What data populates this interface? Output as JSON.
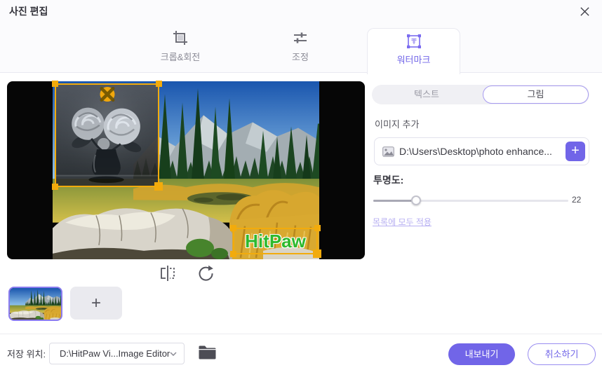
{
  "window": {
    "title": "사진 편집"
  },
  "tabs": {
    "crop": "크롭&회전",
    "adjust": "조정",
    "watermark": "워터마크"
  },
  "watermark_panel": {
    "text_mode": "텍스트",
    "image_mode": "그림",
    "add_image_label": "이미지 추가",
    "image_path": "D:\\Users\\Desktop\\photo enhance...",
    "opacity_label": "투명도:",
    "opacity_value": "22",
    "apply_all_link": "목록에 모두 적용"
  },
  "canvas": {
    "text_watermark": "HitPaw"
  },
  "icons": {
    "plus": "+"
  },
  "footer": {
    "save_label": "저장 위치:",
    "save_path": "D:\\HitPaw Vi...Image Editor",
    "export": "내보내기",
    "cancel": "취소하기"
  },
  "colors": {
    "accent": "#7165e8",
    "selection": "#f2ab0c",
    "wm_green": "#2db92d",
    "link": "#b7aff2"
  }
}
